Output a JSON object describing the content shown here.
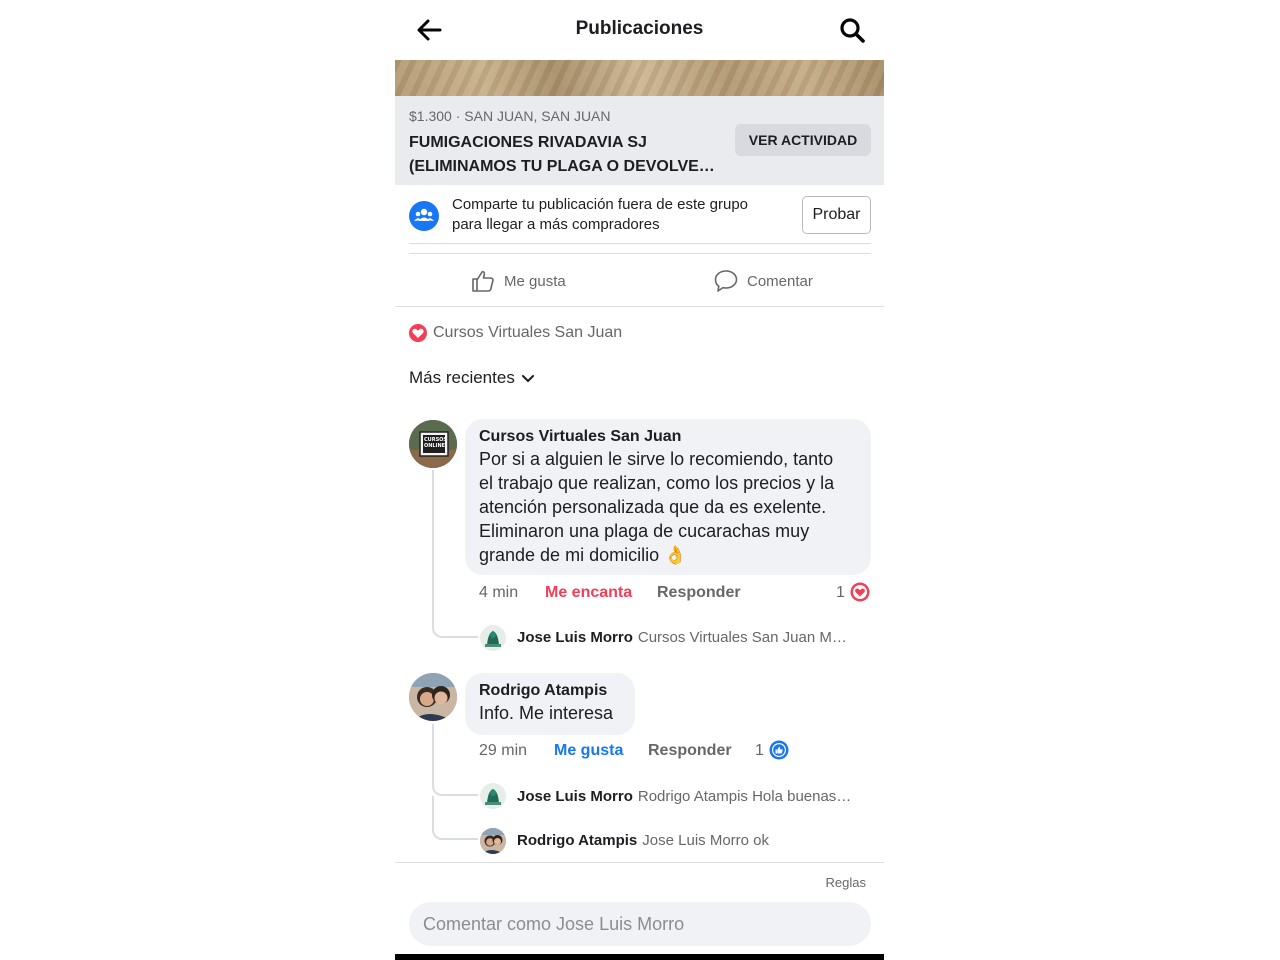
{
  "header": {
    "title": "Publicaciones",
    "back_icon": "arrow-left-icon",
    "search_icon": "search-icon"
  },
  "listing": {
    "meta": "$1.300 · SAN JUAN, SAN JUAN",
    "title_line1": "FUMIGACIONES RIVADAVIA SJ",
    "title_line2": "(ELIMINAMOS TU PLAGA O DEVOLVE…",
    "activity_button": "VER ACTIVIDAD"
  },
  "share_prompt": {
    "text_line1": "Comparte tu publicación fuera de este grupo",
    "text_line2": "para llegar a más compradores",
    "button": "Probar",
    "icon": "group-icon"
  },
  "actions": {
    "like": "Me gusta",
    "comment": "Comentar"
  },
  "reaction_summary": {
    "name": "Cursos Virtuales San Juan",
    "icon": "heart-icon"
  },
  "sort": {
    "label": "Más recientes"
  },
  "comments": [
    {
      "author": "Cursos Virtuales San Juan",
      "avatar_text": "CURSOS ONLINE",
      "lines": [
        "Por si a alguien le sirve lo recomiendo, tanto",
        "el trabajo que realizan, como los precios y la",
        "atención personalizada que da es exelente.",
        "Eliminaron una plaga de cucarachas muy",
        "grande de mi domicilio"
      ],
      "emoji": "👌",
      "time": "4 min",
      "reaction_label": "Me encanta",
      "reply_label": "Responder",
      "reaction_count": "1",
      "reaction_icon": "heart-icon",
      "replies": [
        {
          "author": "Jose Luis Morro",
          "preview": "Cursos Virtuales San Juan M…"
        }
      ]
    },
    {
      "author": "Rodrigo Atampis",
      "text": "Info. Me interesa",
      "time": "29 min",
      "reaction_label": "Me gusta",
      "reply_label": "Responder",
      "reaction_count": "1",
      "reaction_icon": "thumbs-up-icon",
      "replies": [
        {
          "author": "Jose Luis Morro",
          "preview": "Rodrigo Atampis Hola buenas…"
        },
        {
          "author": "Rodrigo Atampis",
          "preview": "Jose Luis Morro ok"
        }
      ]
    }
  ],
  "footer": {
    "rules": "Reglas",
    "comment_placeholder": "Comentar como Jose Luis Morro"
  },
  "colors": {
    "love": "#f33e58",
    "like": "#1877f2",
    "bubble": "#f0f2f5",
    "listing_bg": "#e9ebee"
  }
}
